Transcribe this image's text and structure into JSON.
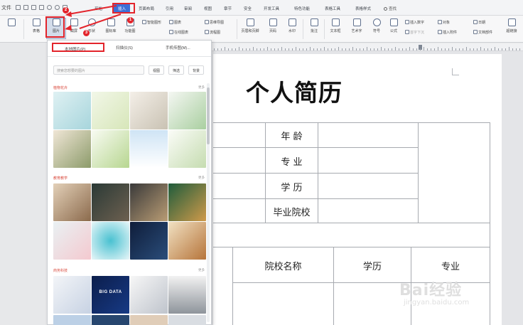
{
  "menubar": {
    "file_label": "文件",
    "tabs": [
      "开始",
      "插入",
      "页面布局",
      "引用",
      "审阅",
      "视图",
      "章节",
      "安全",
      "开发工具",
      "特色功能",
      "表格工具",
      "表格样式"
    ],
    "active_tab": "插入",
    "search_label": "查找"
  },
  "ribbon": {
    "buttons": [
      "表格",
      "图片",
      "截屏",
      "形状",
      "图标库",
      "功能图",
      "页眉和页脚",
      "页码",
      "水印",
      "批注",
      "文本框",
      "艺术字",
      "符号",
      "公式"
    ],
    "small": {
      "smart_graphic": "智能图形",
      "chart": "图表",
      "mind_map": "思维导图",
      "flowchart": "流程图",
      "online_chart": "在线图表",
      "insert_number": "插入数字",
      "object": "对象",
      "date": "日期",
      "attachment": "插入附件",
      "document_parts": "文档部件",
      "hyperlink": "超链接",
      "first_letter": "首字下沉"
    }
  },
  "panel": {
    "tabs": [
      "本地图片(P)",
      "扫描仪(S)",
      "手机传图(M)..."
    ],
    "search_placeholder": "搜索您想要的图片",
    "buttons": [
      "视图",
      "筛选",
      "背景"
    ],
    "sections": [
      "植物花卉",
      "教育教学",
      "商务科技"
    ],
    "more_label": "更多",
    "thumb_caption": "BIG DATA"
  },
  "document": {
    "title": "个人简历",
    "cells": {
      "age": "年  龄",
      "major": "专  业",
      "education": "学  历",
      "school": "毕业院校",
      "school_name": "院校名称",
      "education2": "学历",
      "major2": "专业"
    }
  },
  "annotations": {
    "step1": "1",
    "step2": "2",
    "step3": "3"
  },
  "watermark": {
    "main": "Bai经验",
    "sub": "jingyan.baidu.com"
  },
  "colors": {
    "accent": "#3c6fd6",
    "annotation": "#e3242b"
  }
}
